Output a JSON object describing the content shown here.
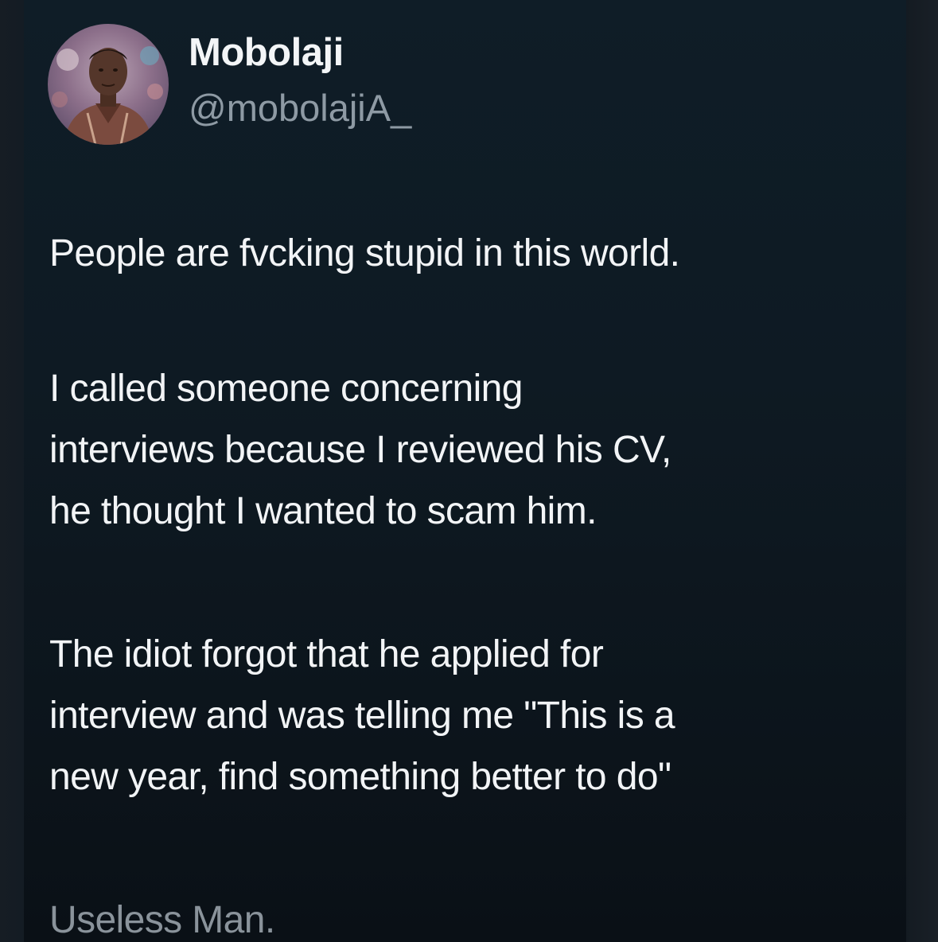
{
  "tweet": {
    "author": {
      "display_name": "Mobolaji",
      "handle": "@mobolajiA_"
    },
    "paragraphs": [
      [
        "People are fvcking stupid in this world."
      ],
      [
        "I called someone concerning",
        "interviews because I reviewed his CV,",
        "he thought I wanted to scam him."
      ],
      [
        "The idiot forgot that he applied for",
        "interview and was telling me \"This is a",
        "new year, find something better to do\""
      ],
      [
        "Useless Man."
      ]
    ]
  },
  "colors": {
    "background": "#0e1a23",
    "text_primary": "#f2f4f6",
    "text_secondary": "#8e9aa4"
  },
  "icons": {
    "avatar": "profile-photo"
  }
}
